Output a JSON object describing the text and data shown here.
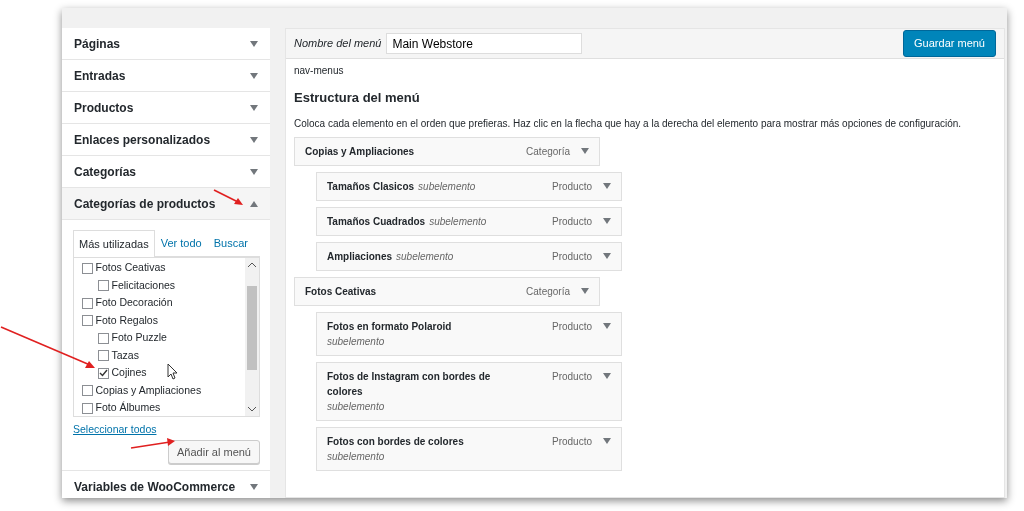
{
  "sidebar": {
    "sections": [
      {
        "title": "Páginas",
        "expanded": false
      },
      {
        "title": "Entradas",
        "expanded": false
      },
      {
        "title": "Productos",
        "expanded": false
      },
      {
        "title": "Enlaces personalizados",
        "expanded": false
      },
      {
        "title": "Categorías",
        "expanded": false
      },
      {
        "title": "Categorías de productos",
        "expanded": true,
        "tabs": [
          {
            "label": "Más utilizadas",
            "selected": true
          },
          {
            "label": "Ver todo",
            "selected": false
          },
          {
            "label": "Buscar",
            "selected": false
          }
        ],
        "checklist": [
          {
            "label": "Fotos Ceativas",
            "checked": false,
            "children": [
              {
                "label": "Felicitaciones",
                "checked": false
              }
            ]
          },
          {
            "label": "Foto Decoración",
            "checked": false
          },
          {
            "label": "Foto Regalos",
            "checked": false,
            "children": [
              {
                "label": "Foto Puzzle",
                "checked": false
              },
              {
                "label": "Tazas",
                "checked": false
              },
              {
                "label": "Cojines",
                "checked": true
              }
            ]
          },
          {
            "label": "Copias y Ampliaciones",
            "checked": false
          },
          {
            "label": "Foto Álbumes",
            "checked": false
          }
        ],
        "select_all": "Seleccionar todos",
        "add_button": "Añadir al menú"
      },
      {
        "title": "Variables de WooCommerce",
        "expanded": false
      }
    ]
  },
  "menu_editor": {
    "name_label": "Nombre del menú",
    "name_value": "Main Webstore",
    "save_button": "Guardar menú",
    "id_text": "nav-menus",
    "heading": "Estructura del menú",
    "description": "Coloca cada elemento en el orden que prefieras. Haz clic en la flecha que hay a la derecha del elemento para mostrar más opciones de configuración.",
    "items": [
      {
        "title": "Copias y Ampliaciones",
        "type": "Categoría",
        "children": [
          {
            "title": "Tamaños Clasicos",
            "note": "subelemento",
            "type": "Producto"
          },
          {
            "title": "Tamaños Cuadrados",
            "note": "subelemento",
            "type": "Producto"
          },
          {
            "title": "Ampliaciones",
            "note": "subelemento",
            "type": "Producto"
          }
        ]
      },
      {
        "title": "Fotos Ceativas",
        "type": "Categoría",
        "children": [
          {
            "title": "Fotos en formato Polaroid",
            "note": "subelemento",
            "type": "Producto"
          },
          {
            "title": "Fotos de Instagram con bordes de colores",
            "note": "subelemento",
            "type": "Producto"
          },
          {
            "title": "Fotos con bordes de colores",
            "note": "subelemento",
            "type": "Producto"
          }
        ]
      }
    ]
  }
}
